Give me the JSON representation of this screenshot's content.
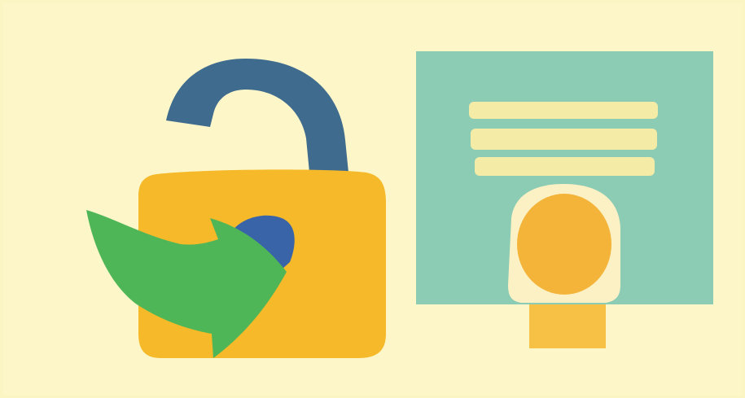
{
  "colors": {
    "background": "#fbf4c3",
    "shackle": "#3f6b8e",
    "lock_body": "#f5b929",
    "keyhole": "#3a64a8",
    "arrow": "#4fb657",
    "card": "#8ccbb4",
    "card_line": "#f3eba6",
    "badge_outline": "#fbf1c4",
    "badge_circle": "#f4b43a",
    "badge_tab": "#f6c144"
  },
  "icons": {
    "lock": "unlocked-padlock-icon",
    "arrow": "green-curved-arrow-icon",
    "card": "id-card-icon",
    "badge": "profile-badge-icon"
  }
}
